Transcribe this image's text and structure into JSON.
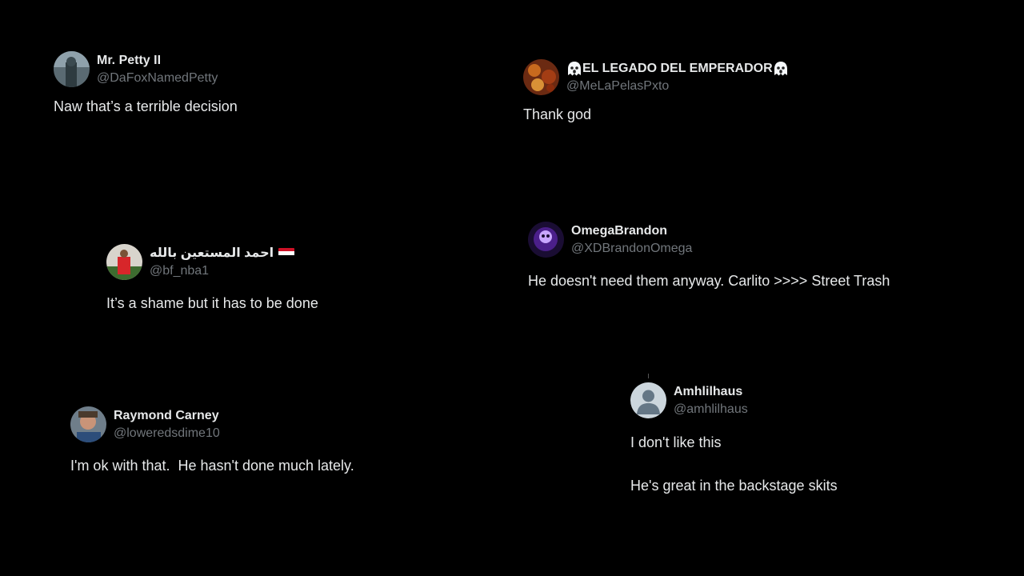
{
  "tweets": [
    {
      "display_name": "Mr. Petty II",
      "handle": "@DaFoxNamedPetty",
      "text": "Naw that’s a terrible decision"
    },
    {
      "display_name": "EL LEGADO DEL EMPERADOR",
      "handle": "@MeLaPelasPxto",
      "text": "Thank god"
    },
    {
      "display_name": "احمد المستعين بالله",
      "handle": "@bf_nba1",
      "text": "It’s a shame but it has to be done"
    },
    {
      "display_name": "OmegaBrandon",
      "handle": "@XDBrandonOmega",
      "text": "He doesn't need them anyway. Carlito >>>> Street Trash"
    },
    {
      "display_name": "Raymond Carney",
      "handle": "@loweredsdime10",
      "text": "I'm ok with that.  He hasn't done much lately."
    },
    {
      "display_name": "Amhlilhaus",
      "handle": "@amhlilhaus",
      "text": "I don't like this\n\nHe's great in the backstage skits"
    }
  ],
  "colors": {
    "background": "#000000",
    "text": "#e7e9ea",
    "handle": "#71767b",
    "flag_red": "#ce1126",
    "flag_white": "#ffffff",
    "flag_black": "#000000",
    "flag_green": "#007a3d"
  },
  "icons": {
    "ghost": "ghost-emoji-icon",
    "flag": "iraq-flag-icon",
    "default_avatar": "default-avatar-icon"
  }
}
